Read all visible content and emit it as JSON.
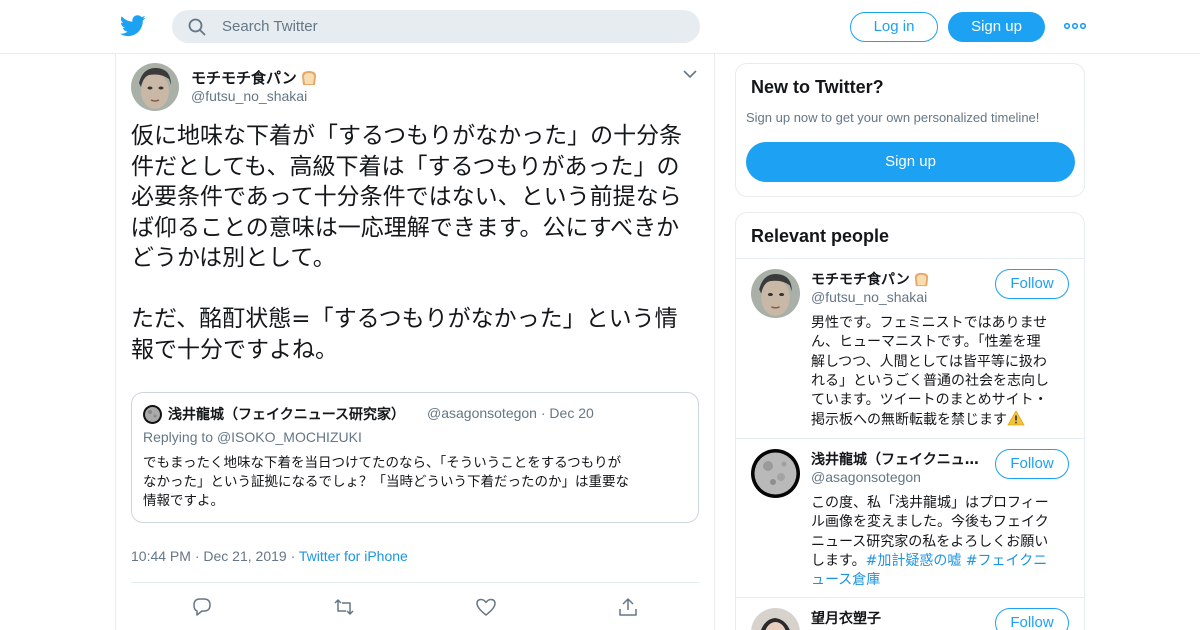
{
  "header": {
    "search_placeholder": "Search Twitter",
    "login_label": "Log in",
    "signup_label": "Sign up"
  },
  "tweet": {
    "author_name": "モチモチ食パン",
    "author_handle": "@futsu_no_shakai",
    "text": "仮に地味な下着が「するつもりがなかった」の十分条\n件だとしても、高級下着は「するつもりがあった」の\n必要条件であって十分条件ではない、という前提なら\nば仰ることの意味は一応理解できます。公にすべきか\nどうかは別として。\n\nただ、酩酊状態=「するつもりがなかった」という情\n報で十分ですよね。",
    "time": "10:44 PM",
    "date": "Dec 21, 2019",
    "source": "Twitter for iPhone",
    "quote": {
      "author_name": "浅井龍城（フェイクニュース研究家）",
      "author_handle": "@asagonsotegon",
      "date": "Dec 20",
      "replying_prefix": "Replying to",
      "replying_to": "@ISOKO_MOCHIZUKI",
      "text": "でもまったく地味な下着を当日つけてたのなら、「そういうことをするつもりが\nなかった」という証拠になるでしょ？「当時どういう下着だったのか」は重要な\n情報ですよ。"
    }
  },
  "sidebar": {
    "new_card": {
      "title": "New to Twitter?",
      "subtitle": "Sign up now to get your own personalized timeline!",
      "button": "Sign up"
    },
    "relevant": {
      "title": "Relevant people",
      "follow_label": "Follow",
      "people": [
        {
          "name": "モチモチ食パン",
          "handle": "@futsu_no_shakai",
          "bio": "男性です。フェミニストではありませ\nん、ヒューマニストです。「性差を理\n解しつつ、人間としては皆平等に扱わ\nれる」というごく普通の社会を志向し\nています。ツイートのまとめサイト・\n掲示板への無断転載を禁じます"
        },
        {
          "name": "浅井龍城（フェイクニュース研究家）",
          "handle": "@asagonsotegon",
          "bio_text": "この度、私「浅井龍城」はプロフィー\nル画像を変えました。今後もフェイク\nニュース研究家の私をよろしくお願い\nします。",
          "bio_tags": "#加計疑惑の嘘 #フェイクニ\nュース倉庫"
        },
        {
          "name": "望月衣塑子",
          "handle": ""
        }
      ]
    }
  },
  "colors": {
    "accent": "#1da1f2",
    "link": "#1b95e0",
    "secondary_text": "#657786",
    "border": "#e6ecf0"
  },
  "icons": [
    "twitter-bird-icon",
    "search-icon",
    "more-icon",
    "chevron-down-icon",
    "reply-icon",
    "retweet-icon",
    "like-icon",
    "share-icon",
    "bread-emoji-icon",
    "warning-icon"
  ]
}
